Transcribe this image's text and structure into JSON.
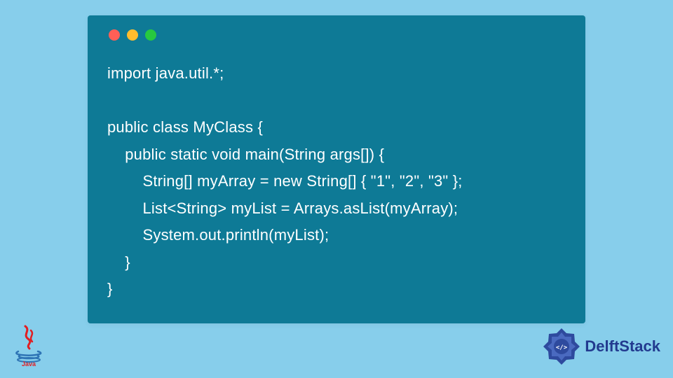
{
  "code": {
    "line1": "import java.util.*;",
    "line2": "",
    "line3": "public class MyClass {",
    "line4": "    public static void main(String args[]) {",
    "line5": "        String[] myArray = new String[] { \"1\", \"2\", \"3\" };",
    "line6": "        List<String> myList = Arrays.asList(myArray);",
    "line7": "        System.out.println(myList);",
    "line8": "    }",
    "line9": "}"
  },
  "logos": {
    "java_label": "Java",
    "delft_label": "DelftStack"
  },
  "colors": {
    "background": "#87ceeb",
    "window": "#0e7a96",
    "code_text": "#ffffff",
    "dot_red": "#ff5f56",
    "dot_yellow": "#ffbd2e",
    "dot_green": "#27c93f",
    "delft_blue": "#223a8f",
    "java_red": "#e11e22",
    "java_blue": "#2e74b5"
  }
}
